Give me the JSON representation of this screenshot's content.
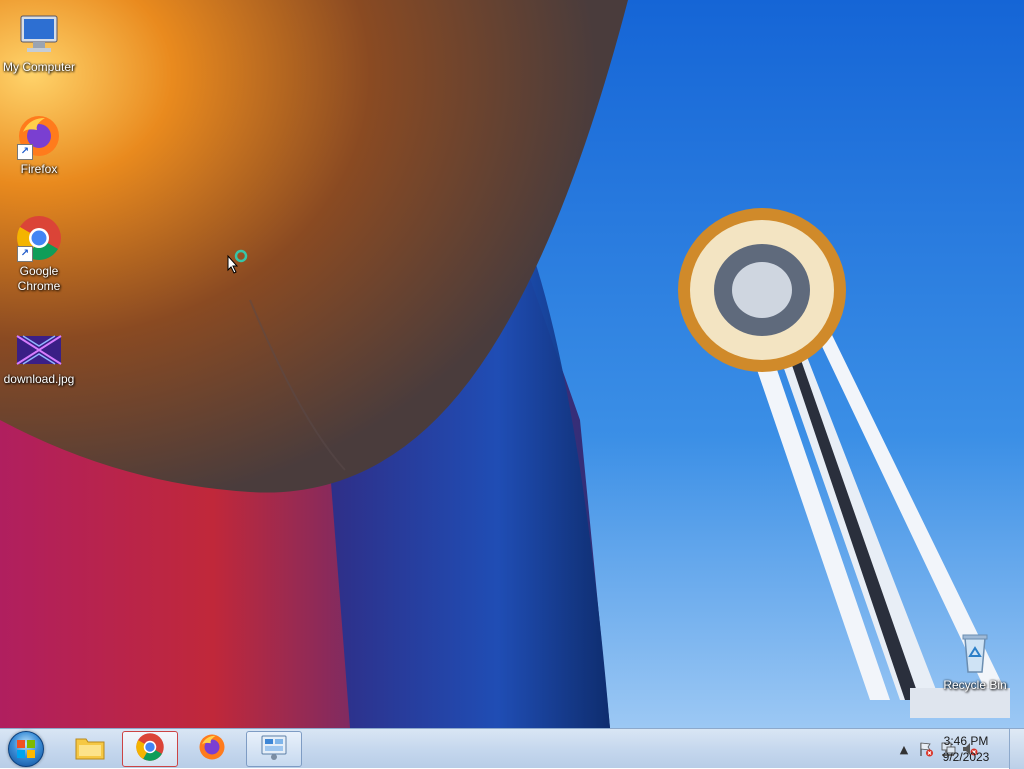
{
  "desktop": {
    "icons": [
      {
        "label": "My Computer",
        "icon": "computer-icon"
      },
      {
        "label": "Firefox",
        "icon": "firefox-icon"
      },
      {
        "label": "Google\nChrome",
        "icon": "chrome-icon"
      },
      {
        "label": "download.jpg",
        "icon": "image-file-icon"
      },
      {
        "label": "Recycle Bin",
        "icon": "recycle-bin-icon"
      }
    ]
  },
  "taskbar": {
    "start": {
      "icon": "windows-start-icon"
    },
    "apps": [
      {
        "name": "File Explorer",
        "icon": "folder-icon",
        "state": "pinned"
      },
      {
        "name": "Google Chrome",
        "icon": "chrome-icon",
        "state": "active"
      },
      {
        "name": "Firefox",
        "icon": "firefox-icon",
        "state": "pinned"
      },
      {
        "name": "Control Panel",
        "icon": "control-panel-icon",
        "state": "open"
      }
    ],
    "tray": {
      "icons": [
        "show-hidden-icons-icon",
        "action-center-flag-icon",
        "network-icon",
        "volume-muted-icon"
      ],
      "time": "3:46 PM",
      "date": "9/2/2023"
    },
    "colors": {
      "bar_top": "#d9e6f4",
      "bar_bottom": "#b8cde7",
      "active_border": "#cc4444"
    }
  }
}
